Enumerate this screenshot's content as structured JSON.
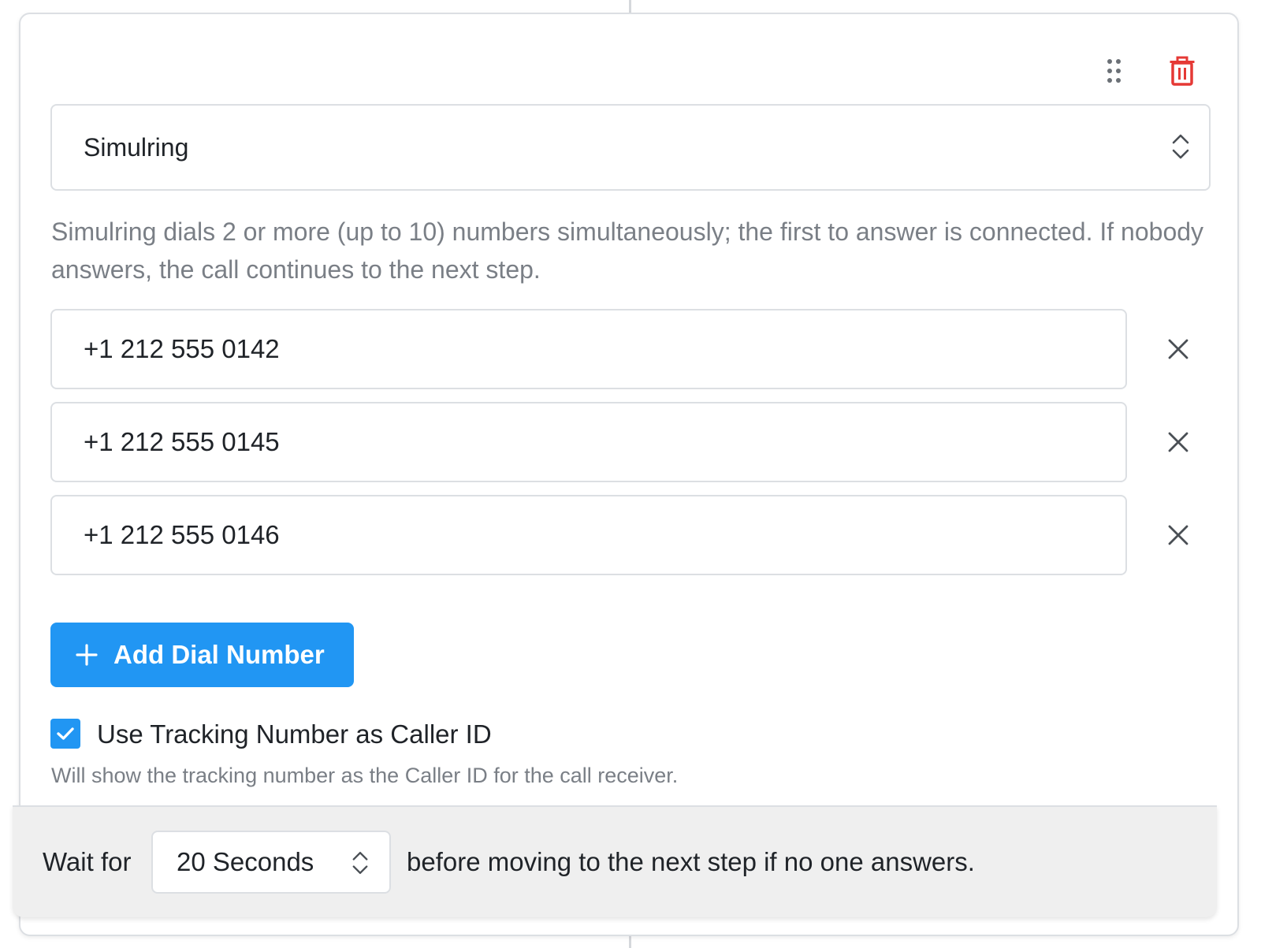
{
  "step": {
    "type_select": {
      "selected": "Simulring"
    },
    "description": "Simulring dials 2 or more (up to 10) numbers simultaneously; the first to answer is connected. If nobody answers, the call continues to the next step.",
    "dial_numbers": [
      "+1 212 555 0142",
      "+1 212 555 0145",
      "+1 212 555 0146"
    ],
    "add_button_label": "Add Dial Number",
    "caller_id": {
      "checked": true,
      "label": "Use Tracking Number as Caller ID",
      "help": "Will show the tracking number as the Caller ID for the call receiver."
    },
    "wait": {
      "prefix": "Wait for",
      "selected": "20 Seconds",
      "suffix": "before moving to the next step if no one answers."
    }
  },
  "icons": {
    "drag": "drag-handle-icon",
    "delete": "trash-icon",
    "select": "chevron-up-down-icon",
    "remove": "close-icon",
    "add": "plus-icon",
    "checkbox": "check-icon"
  },
  "colors": {
    "primary": "#2196f3",
    "danger": "#e53935",
    "muted_text": "#7a7f86",
    "border": "#dcdfe3",
    "footer_bg": "#efefef"
  }
}
